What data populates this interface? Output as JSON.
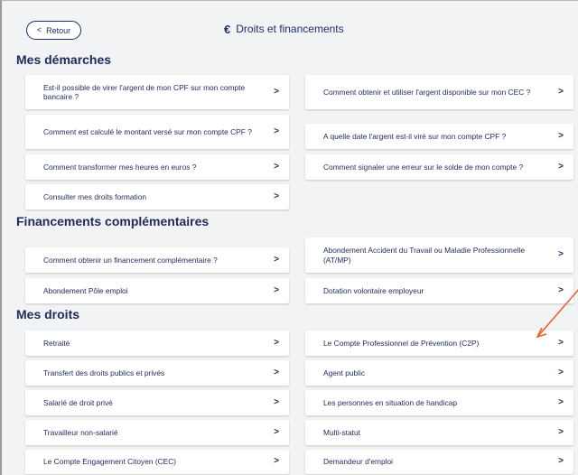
{
  "header": {
    "back_label": "Retour",
    "back_chevron": "<",
    "title": "Droits et financements",
    "title_icon": "€"
  },
  "sections": {
    "demarches": "Mes démarches",
    "financements": "Financements complémentaires",
    "droits": "Mes droits"
  },
  "chevron": ">",
  "cards": {
    "d1": "Est-il possible de virer l'argent de mon CPF sur mon compte bancaire ?",
    "d2": "Comment obtenir et utiliser l'argent disponible sur mon CEC ?",
    "d3": "Comment est calculé le montant versé sur mon compte CPF ?",
    "d4": "A quelle date l'argent est-il viré sur mon compte CPF ?",
    "d5": "Comment transformer mes heures en euros ?",
    "d6": "Comment signaler une erreur sur le solde de mon compte ?",
    "d7": "Consulter mes droits formation",
    "f1": "Comment obtenir un financement complémentaire ?",
    "f2": "Abondement Accident du Travail ou Maladie Professionnelle (AT/MP)",
    "f3": "Abondement Pôle emploi",
    "f4": "Dotation volontaire employeur",
    "r1": "Retraité",
    "r2": "Le Compte Professionnel de Prévention (C2P)",
    "r3": "Transfert des droits publics et privés",
    "r4": "Agent public",
    "r5": "Salarié de droit privé",
    "r6": "Les personnes en situation de handicap",
    "r7": "Travailleur non-salarié",
    "r8": "Multi-statut",
    "r9": "Le Compte Engagement Citoyen (CEC)",
    "r10": "Demandeur d'emploi"
  },
  "annotation": {
    "color": "#e8642c"
  }
}
